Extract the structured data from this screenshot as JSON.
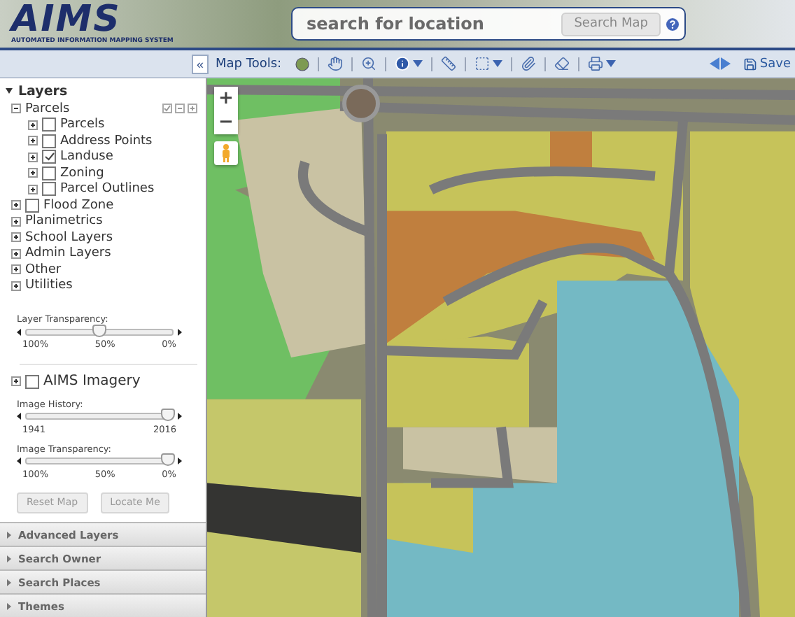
{
  "header": {
    "logo": "AIMS",
    "tagline": "AUTOMATED INFORMATION MAPPING SYSTEM",
    "search": {
      "placeholder": "search for location",
      "button": "Search Map"
    }
  },
  "toolbar": {
    "collapse": "«",
    "label": "Map Tools:",
    "save": "Save"
  },
  "layers": {
    "title": "Layers",
    "expanded": true,
    "items": [
      {
        "kind": "group",
        "label": "Parcels",
        "expanded": true,
        "children": [
          {
            "kind": "layer",
            "label": "Parcels",
            "checked": false,
            "expanded": false
          },
          {
            "kind": "layer",
            "label": "Address Points",
            "checked": false,
            "expanded": false
          },
          {
            "kind": "layer",
            "label": "Landuse",
            "checked": true,
            "expanded": false
          },
          {
            "kind": "layer",
            "label": "Zoning",
            "checked": false,
            "expanded": false
          },
          {
            "kind": "layer",
            "label": "Parcel Outlines",
            "checked": false,
            "expanded": false
          }
        ]
      },
      {
        "kind": "layer",
        "label": "Flood Zone",
        "checked": false,
        "expanded": false
      },
      {
        "kind": "group",
        "label": "Planimetrics",
        "expanded": false
      },
      {
        "kind": "group",
        "label": "School Layers",
        "expanded": false
      },
      {
        "kind": "group",
        "label": "Admin Layers",
        "expanded": false
      },
      {
        "kind": "group",
        "label": "Other",
        "expanded": false
      },
      {
        "kind": "group",
        "label": "Utilities",
        "expanded": false
      }
    ]
  },
  "layer_transparency": {
    "label": "Layer Transparency:",
    "level": 0.5,
    "ticks": [
      "100%",
      "50%",
      "0%"
    ]
  },
  "imagery": {
    "label": "AIMS Imagery",
    "checked": false,
    "expanded": false,
    "sliders": [
      {
        "label": "Image History:",
        "level": 0.97,
        "ticks": [
          "1941",
          "2016"
        ]
      },
      {
        "label": "Image Transparency:",
        "level": 0.97,
        "ticks": [
          "100%",
          "50%",
          "0%"
        ]
      }
    ]
  },
  "buttons": [
    "Reset Map",
    "Locate Me"
  ],
  "panels": [
    {
      "label": "Advanced Layers",
      "expanded": false
    },
    {
      "label": "Search Owner",
      "expanded": false
    },
    {
      "label": "Search Places",
      "expanded": false
    },
    {
      "label": "Themes",
      "expanded": false
    }
  ],
  "map": {
    "zoom_in": "+",
    "zoom_out": "−"
  }
}
